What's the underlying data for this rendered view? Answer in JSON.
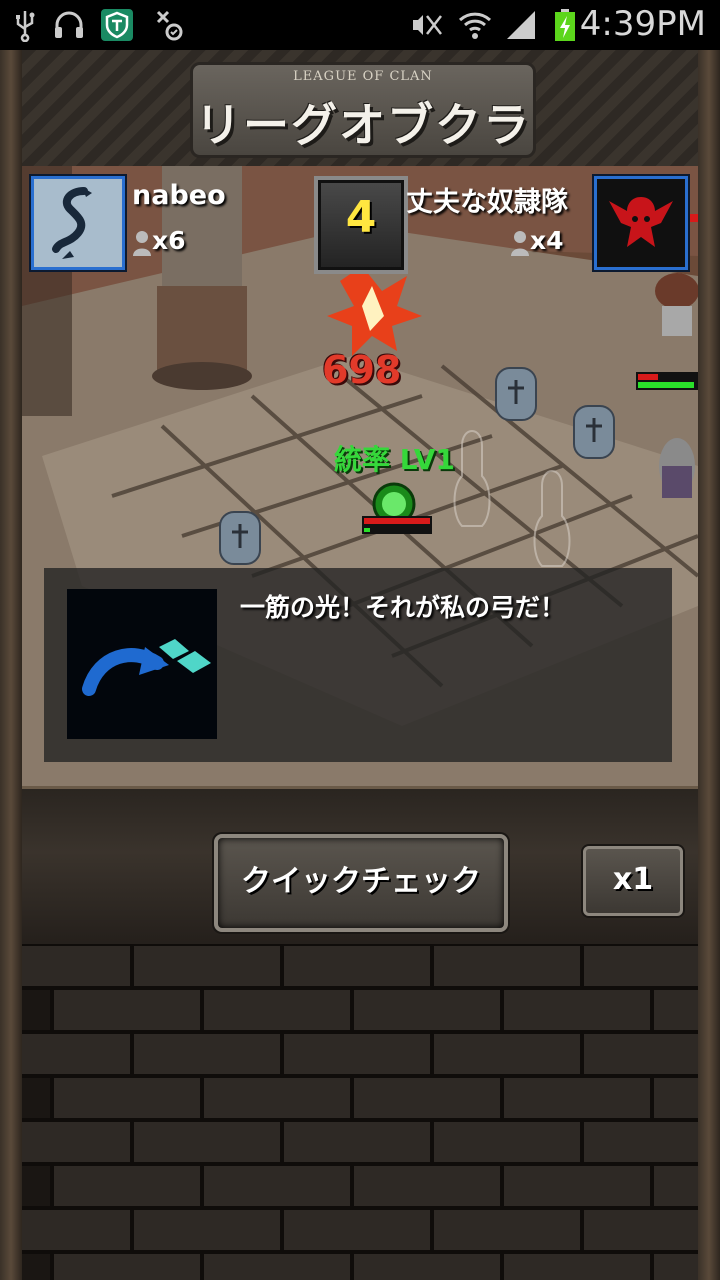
{
  "status_bar": {
    "time": "4:39PM",
    "icons": [
      "usb-icon",
      "headphones-icon",
      "shield-app-icon",
      "usb-debug-icon",
      "mute-icon",
      "wifi-icon",
      "signal-icon",
      "battery-charging-icon"
    ]
  },
  "header": {
    "logo_subtitle": "LEAGUE OF CLAN",
    "logo_title": "リーグオブクラン"
  },
  "battle": {
    "player": {
      "name": "nabeo",
      "count": "x6",
      "avatar": "dragon-avatar-icon"
    },
    "turn": "4",
    "enemy": {
      "name": "丈夫な奴隷隊",
      "count": "x4",
      "avatar": "demon-avatar-icon"
    },
    "damage": "698",
    "status_text": "統率 LV1"
  },
  "dialog": {
    "quote": "一筋の光！それが私の弓だ！",
    "icon": "skill-arrow-icon"
  },
  "controls": {
    "quick_check_label": "クイックチェック",
    "speed_label": "x1"
  }
}
